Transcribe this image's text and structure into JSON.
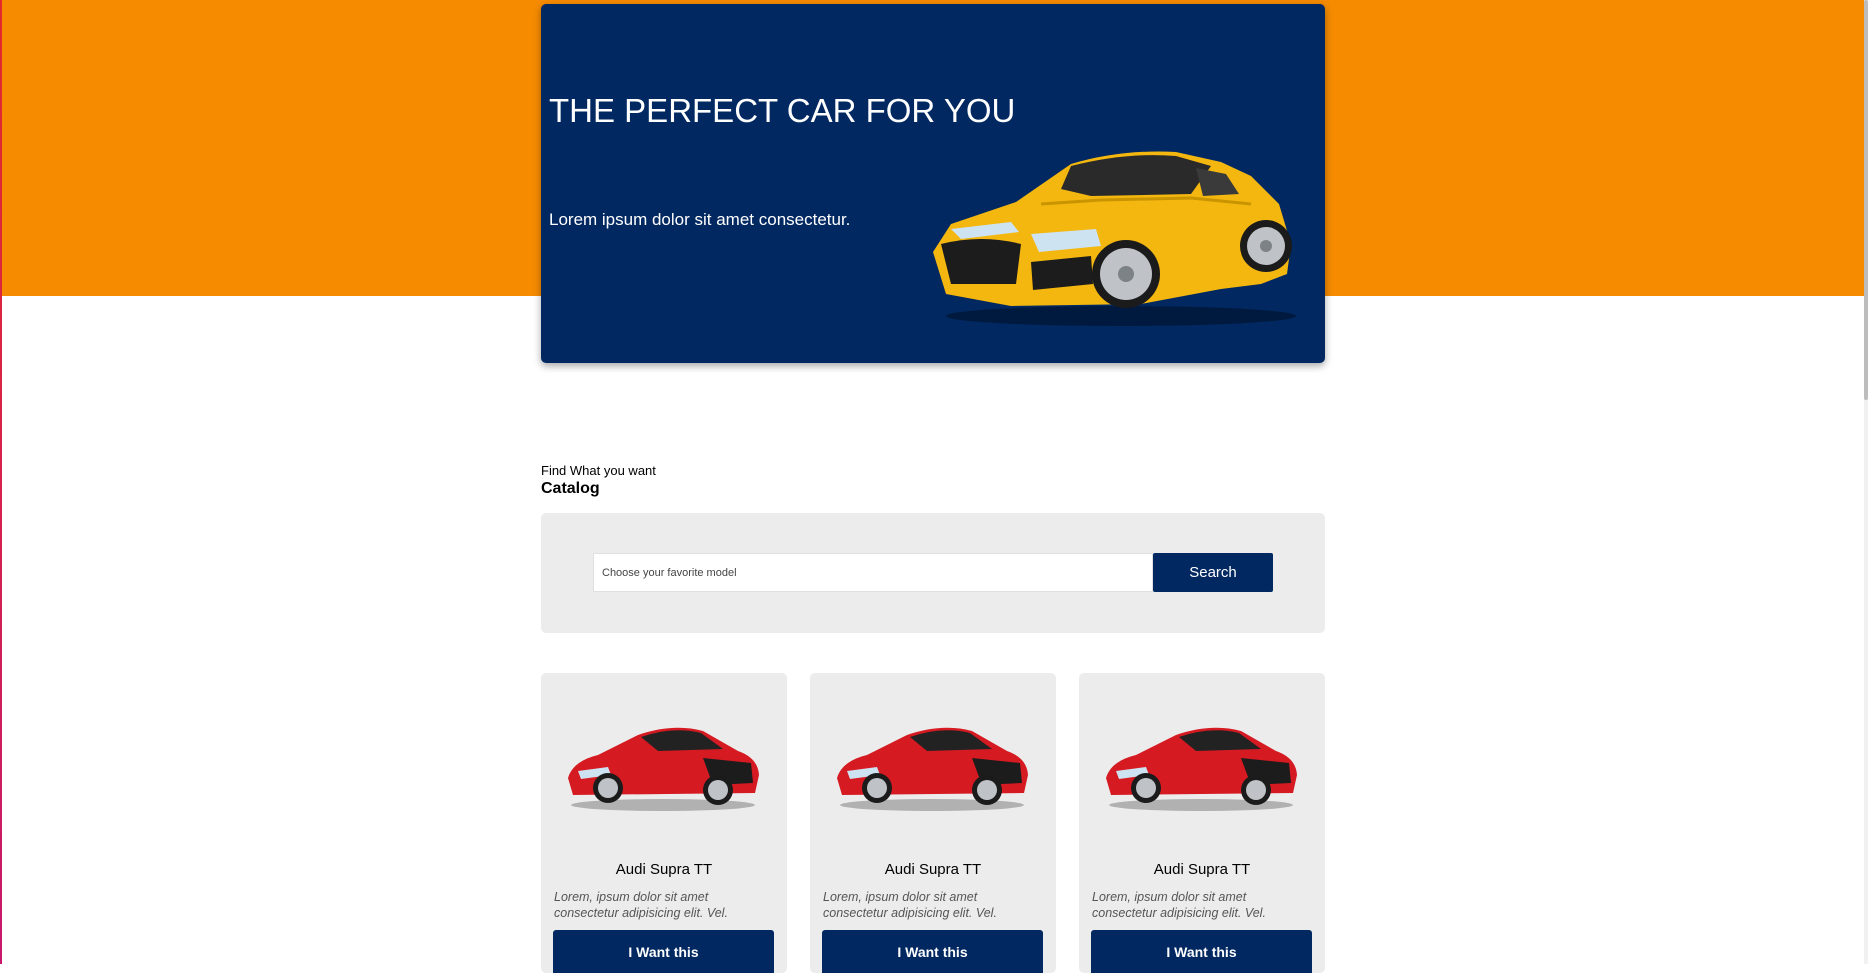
{
  "colors": {
    "accent_orange": "#f68b00",
    "navy": "#012861",
    "panel_gray": "#ececec",
    "car_yellow": "#f3b70f",
    "car_red": "#d51a22"
  },
  "hero": {
    "title": "THE PERFECT CAR FOR YOU",
    "subtitle": "Lorem ipsum dolor sit amet consectetur.",
    "image_icon": "yellow-sports-car"
  },
  "catalog": {
    "kicker": "Find What you want",
    "title": "Catalog",
    "search": {
      "placeholder": "Choose your favorite model",
      "button_label": "Search"
    }
  },
  "cards": [
    {
      "title": "Audi Supra TT",
      "description": "Lorem, ipsum dolor sit amet consectetur adipisicing elit. Vel.",
      "button_label": "I Want this",
      "image_icon": "red-sports-car"
    },
    {
      "title": "Audi Supra TT",
      "description": "Lorem, ipsum dolor sit amet consectetur adipisicing elit. Vel.",
      "button_label": "I Want this",
      "image_icon": "red-sports-car"
    },
    {
      "title": "Audi Supra TT",
      "description": "Lorem, ipsum dolor sit amet consectetur adipisicing elit. Vel.",
      "button_label": "I Want this",
      "image_icon": "red-sports-car"
    }
  ]
}
